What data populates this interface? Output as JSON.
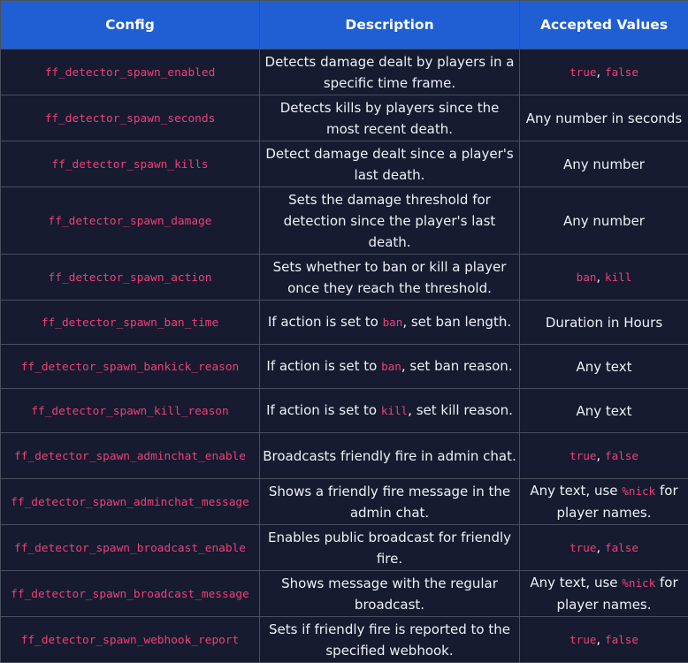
{
  "headers": {
    "config": "Config",
    "description": "Description",
    "accepted": "Accepted Values"
  },
  "rows": [
    {
      "config": "ff_detector_spawn_enabled",
      "description": "Detects damage dealt by players in a specific time frame.",
      "accepted_codes": [
        "true",
        "false"
      ]
    },
    {
      "config": "ff_detector_spawn_seconds",
      "description": "Detects kills by players since the most recent death.",
      "accepted_text": "Any number in seconds"
    },
    {
      "config": "ff_detector_spawn_kills",
      "description": "Detect damage dealt since a player's last death.",
      "accepted_text": "Any number"
    },
    {
      "config": "ff_detector_spawn_damage",
      "description": "Sets the damage threshold for detection since the player's last death.",
      "accepted_text": "Any number"
    },
    {
      "config": "ff_detector_spawn_action",
      "description": "Sets whether to ban or kill a player once they reach the threshold.",
      "accepted_codes": [
        "ban",
        "kill"
      ]
    },
    {
      "config": "ff_detector_spawn_ban_time",
      "description_pre": "If action is set to",
      "description_code": "ban",
      "description_post": ", set ban length.",
      "accepted_text": "Duration in Hours"
    },
    {
      "config": "ff_detector_spawn_bankick_reason",
      "description_pre": "If action is set to",
      "description_code": "ban",
      "description_post": ", set ban reason.",
      "accepted_text": "Any text"
    },
    {
      "config": "ff_detector_spawn_kill_reason",
      "description_pre": "If action is set to",
      "description_code": "kill",
      "description_post": ", set kill reason.",
      "accepted_text": "Any text"
    },
    {
      "config": "ff_detector_spawn_adminchat_enable",
      "description": "Broadcasts friendly fire in admin chat.",
      "accepted_codes": [
        "true",
        "false"
      ]
    },
    {
      "config": "ff_detector_spawn_adminchat_message",
      "description": "Shows a friendly fire message in the admin chat.",
      "accepted_pre": "Any text, use",
      "accepted_code": "%nick",
      "accepted_post": "for player names."
    },
    {
      "config": "ff_detector_spawn_broadcast_enable",
      "description": "Enables public broadcast for friendly fire.",
      "accepted_codes": [
        "true",
        "false"
      ]
    },
    {
      "config": "ff_detector_spawn_broadcast_message",
      "description": "Shows message with the regular broadcast.",
      "accepted_pre": "Any text, use",
      "accepted_code": "%nick",
      "accepted_post": "for player names."
    },
    {
      "config": "ff_detector_spawn_webhook_report",
      "description": "Sets if friendly fire is reported to the specified webhook.",
      "accepted_codes": [
        "true",
        "false"
      ]
    }
  ],
  "separator": ","
}
